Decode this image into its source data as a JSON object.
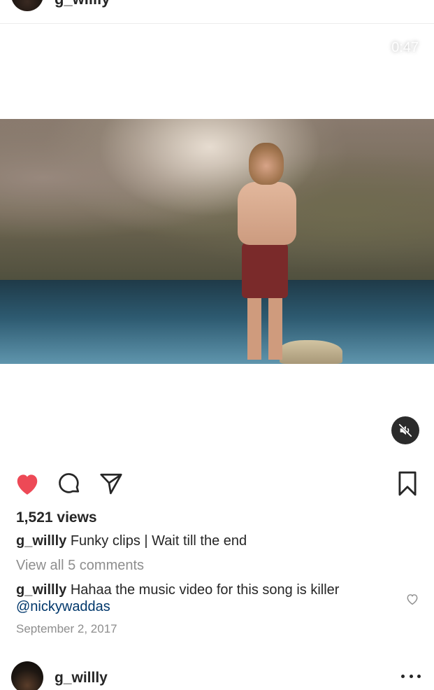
{
  "header": {
    "username": "g_willly"
  },
  "video": {
    "duration": "0:47"
  },
  "actions": {
    "liked": true,
    "like_color": "#ed4956"
  },
  "post": {
    "views": "1,521 views",
    "caption_user": "g_willly",
    "caption_text": "Funky clips | Wait till the end",
    "view_comments": "View all 5 comments",
    "comment_user": "g_willly",
    "comment_text": "Hahaa the music video for this song is killer",
    "comment_mention": "@nickywaddas",
    "date": "September 2, 2017"
  },
  "next_post": {
    "username": "g_willly"
  },
  "icons": {
    "like": "heart-icon",
    "comment": "comment-icon",
    "share": "paper-plane-icon",
    "save": "bookmark-icon",
    "mute": "muted-speaker-icon",
    "comment_like": "small-heart-icon",
    "more": "more-icon"
  }
}
